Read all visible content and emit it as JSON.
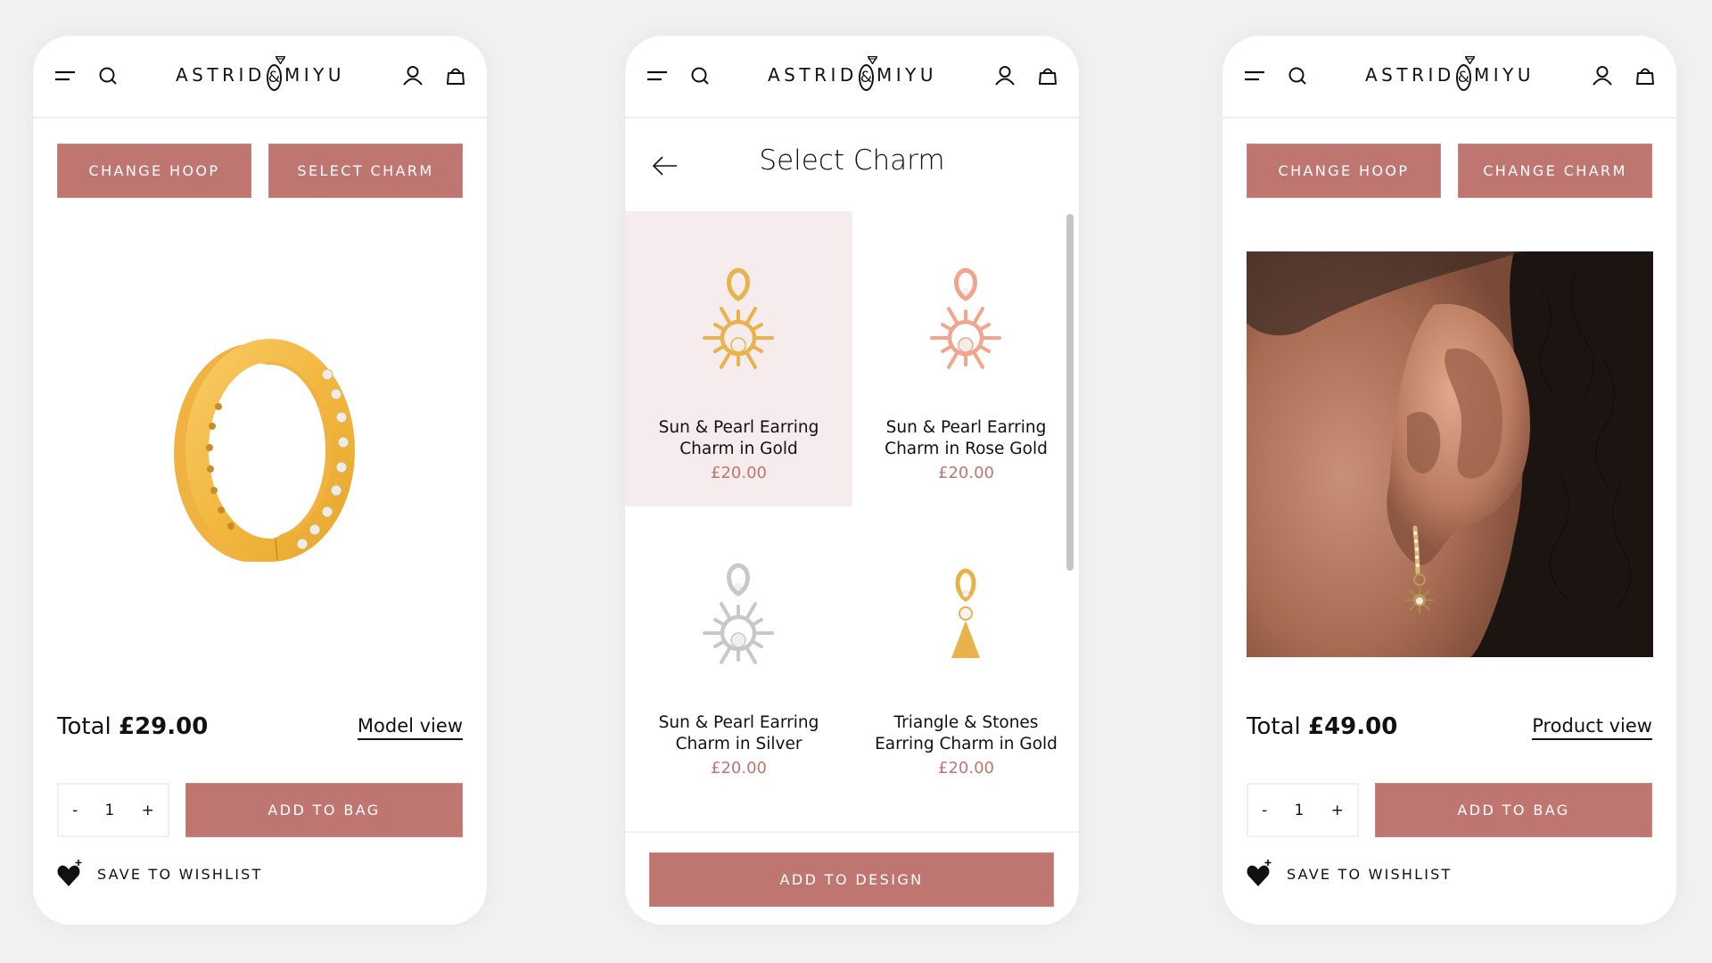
{
  "brand": {
    "logo_left": "ASTRID",
    "logo_amp": "&",
    "logo_right": "MIYU"
  },
  "colors": {
    "accent": "#c07670",
    "selected_bg": "#f6eced",
    "background": "#f1f1f1"
  },
  "screens": {
    "product": {
      "buttons": {
        "change_hoop": "Change Hoop",
        "select_charm": "Select Charm"
      },
      "total_label": "Total",
      "total_value": "£29.00",
      "view_link": "Model view",
      "quantity": {
        "minus": "-",
        "value": "1",
        "plus": "+"
      },
      "add_to_bag": "Add to bag",
      "wishlist": "Save to wishlist",
      "image_alt": "gold-pave-hoop"
    },
    "select_charm": {
      "title": "Select Charm",
      "back_icon": "arrow-left-icon",
      "charms": [
        {
          "name_line1": "Sun & Pearl Earring",
          "name_line2": "Charm in Gold",
          "price": "£20.00",
          "metal": "#e9b24b",
          "selected": true
        },
        {
          "name_line1": "Sun & Pearl Earring",
          "name_line2": "Charm in Rose Gold",
          "price": "£20.00",
          "metal": "#f2a58c",
          "selected": false
        },
        {
          "name_line1": "Sun & Pearl Earring",
          "name_line2": "Charm in Silver",
          "price": "£20.00",
          "metal": "#c8c8c8",
          "selected": false
        },
        {
          "name_line1": "Triangle & Stones",
          "name_line2": "Earring Charm in Gold",
          "price": "£20.00",
          "metal": "#e9b24b",
          "selected": false
        }
      ],
      "add_to_design": "Add to design"
    },
    "model": {
      "buttons": {
        "change_hoop": "Change Hoop",
        "change_charm": "Change Charm"
      },
      "total_label": "Total",
      "total_value": "£49.00",
      "view_link": "Product view",
      "quantity": {
        "minus": "-",
        "value": "1",
        "plus": "+"
      },
      "add_to_bag": "Add to bag",
      "wishlist": "Save to wishlist",
      "image_alt": "model-ear-with-hoop-and-sun-charm"
    }
  },
  "icons": {
    "menu": "menu-icon",
    "search": "search-icon",
    "account": "user-icon",
    "bag": "bag-icon",
    "wishlist": "heart-plus-icon"
  }
}
